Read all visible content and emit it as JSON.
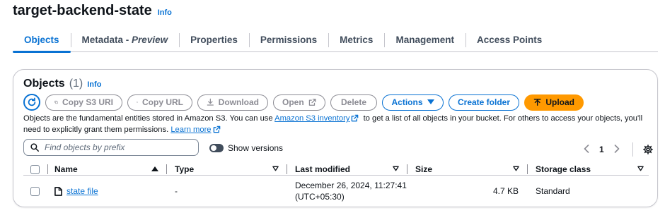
{
  "bucket": {
    "name": "target-backend-state",
    "info_label": "Info"
  },
  "tabs": [
    {
      "label": "Objects",
      "active": true
    },
    {
      "label": "Metadata - ",
      "suffix": "Preview"
    },
    {
      "label": "Properties"
    },
    {
      "label": "Permissions"
    },
    {
      "label": "Metrics"
    },
    {
      "label": "Management"
    },
    {
      "label": "Access Points"
    }
  ],
  "objects_panel": {
    "title": "Objects",
    "count": "(1)",
    "info_label": "Info",
    "toolbar": {
      "copy_s3_uri": "Copy S3 URI",
      "copy_url": "Copy URL",
      "download": "Download",
      "open": "Open",
      "delete": "Delete",
      "actions": "Actions",
      "create_folder": "Create folder",
      "upload": "Upload"
    },
    "description": {
      "part1": "Objects are the fundamental entities stored in Amazon S3. You can use ",
      "inventory_link": "Amazon S3 inventory",
      "part2": " to get a list of all objects in your bucket. For others to access your objects, you'll need to explicitly grant them permissions. ",
      "learn_more": "Learn more"
    },
    "search": {
      "placeholder": "Find objects by prefix",
      "value": ""
    },
    "show_versions": {
      "label": "Show versions",
      "enabled": false
    },
    "pagination": {
      "current_page": "1"
    },
    "table": {
      "columns": {
        "name": "Name",
        "type": "Type",
        "last_modified": "Last modified",
        "size": "Size",
        "storage_class": "Storage class"
      },
      "rows": [
        {
          "name": "state file",
          "type": "-",
          "last_modified_line1": "December 26, 2024, 11:27:41",
          "last_modified_line2": "(UTC+05:30)",
          "size": "4.7 KB",
          "storage_class": "Standard"
        }
      ]
    }
  },
  "colors": {
    "link": "#0972d3",
    "upload_button": "#ff9900",
    "disabled": "#8c8c94",
    "border": "#c6c6cd"
  },
  "icons": {
    "refresh": "refresh-icon",
    "copy": "copy-icon",
    "download": "download-icon",
    "external": "external-link-icon",
    "caret": "caret-down-icon",
    "upload": "upload-arrow-icon",
    "search": "search-icon",
    "settings": "gear-icon",
    "file": "file-icon"
  }
}
